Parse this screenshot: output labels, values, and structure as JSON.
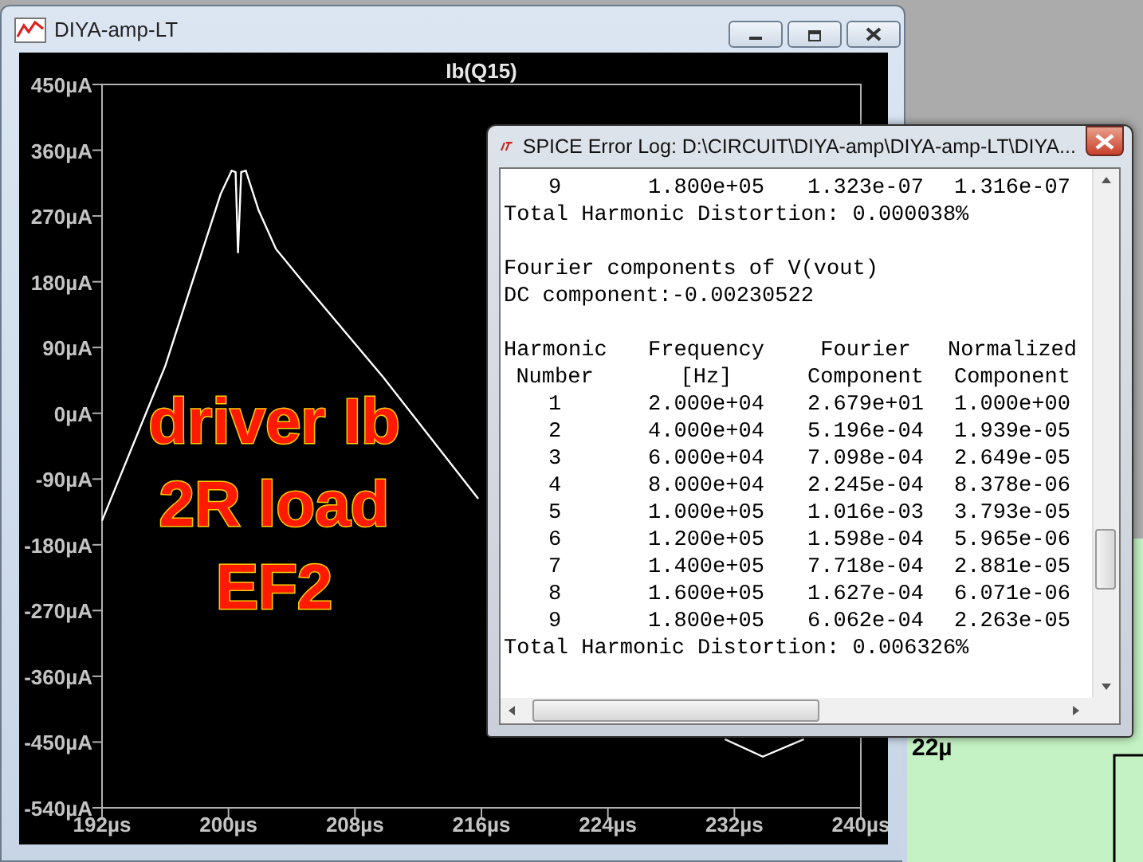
{
  "plot_window": {
    "title": "DIYA-amp-LT",
    "chart_data": {
      "type": "line",
      "title": "Ib(Q15)",
      "x": [
        192,
        196,
        199.5,
        200.2,
        200.45,
        200.6,
        200.8,
        201.1,
        201.9,
        203,
        204.7,
        209.8,
        215.8,
        231.4,
        233.8,
        236.4
      ],
      "series": [
        {
          "color": "#ffffff",
          "values": [
            -147,
            65,
            300,
            332,
            330,
            219,
            330,
            332,
            278,
            225,
            180,
            49,
            -117,
            null,
            null,
            null
          ]
        },
        {
          "color": "#ffffff",
          "values": [
            null,
            null,
            null,
            null,
            null,
            null,
            null,
            null,
            null,
            null,
            null,
            null,
            null,
            -446,
            -470,
            -446
          ]
        }
      ],
      "xlim": [
        192,
        240
      ],
      "ylim": [
        -540,
        450
      ],
      "xticks": [
        {
          "value": 192,
          "label": "192µs"
        },
        {
          "value": 200,
          "label": "200µs"
        },
        {
          "value": 208,
          "label": "208µs"
        },
        {
          "value": 216,
          "label": "216µs"
        },
        {
          "value": 224,
          "label": "224µs"
        },
        {
          "value": 232,
          "label": "232µs"
        },
        {
          "value": 240,
          "label": "240µs"
        }
      ],
      "yticks": [
        {
          "value": 450,
          "label": "450µA"
        },
        {
          "value": 360,
          "label": "360µA"
        },
        {
          "value": 270,
          "label": "270µA"
        },
        {
          "value": 180,
          "label": "180µA"
        },
        {
          "value": 90,
          "label": "90µA"
        },
        {
          "value": 0,
          "label": "0µA"
        },
        {
          "value": -90,
          "label": "-90µA"
        },
        {
          "value": -180,
          "label": "-180µA"
        },
        {
          "value": -270,
          "label": "-270µA"
        },
        {
          "value": -360,
          "label": "-360µA"
        },
        {
          "value": -450,
          "label": "-450µA"
        },
        {
          "value": -540,
          "label": "-540µA"
        }
      ]
    },
    "overlay_caption": [
      "driver Ib",
      "2R load",
      "EF2"
    ]
  },
  "schematic_window": {
    "labels": [
      "22µ"
    ]
  },
  "log_window": {
    "title": "SPICE Error Log: D:\\CIRCUIT\\DIYA-amp\\DIYA-amp-LT\\DIYA...",
    "entries": [
      {
        "kind": "row",
        "cells": [
          "9",
          "1.800e+05",
          "1.323e-07",
          "1.316e-07"
        ]
      },
      {
        "kind": "text",
        "text": "Total Harmonic Distortion: 0.000038%"
      },
      {
        "kind": "gap"
      },
      {
        "kind": "text",
        "text": "Fourier components of V(vout)"
      },
      {
        "kind": "text",
        "text": "DC component:-0.00230522"
      },
      {
        "kind": "gap"
      },
      {
        "kind": "header",
        "cells": [
          "Harmonic",
          "Frequency",
          "Fourier",
          "Normalized"
        ]
      },
      {
        "kind": "header",
        "cells": [
          "Number",
          "[Hz]",
          "Component",
          "Component"
        ]
      },
      {
        "kind": "row",
        "cells": [
          "1",
          "2.000e+04",
          "2.679e+01",
          "1.000e+00"
        ]
      },
      {
        "kind": "row",
        "cells": [
          "2",
          "4.000e+04",
          "5.196e-04",
          "1.939e-05"
        ]
      },
      {
        "kind": "row",
        "cells": [
          "3",
          "6.000e+04",
          "7.098e-04",
          "2.649e-05"
        ]
      },
      {
        "kind": "row",
        "cells": [
          "4",
          "8.000e+04",
          "2.245e-04",
          "8.378e-06"
        ]
      },
      {
        "kind": "row",
        "cells": [
          "5",
          "1.000e+05",
          "1.016e-03",
          "3.793e-05"
        ]
      },
      {
        "kind": "row",
        "cells": [
          "6",
          "1.200e+05",
          "1.598e-04",
          "5.965e-06"
        ]
      },
      {
        "kind": "row",
        "cells": [
          "7",
          "1.400e+05",
          "7.718e-04",
          "2.881e-05"
        ]
      },
      {
        "kind": "row",
        "cells": [
          "8",
          "1.600e+05",
          "1.627e-04",
          "6.071e-06"
        ]
      },
      {
        "kind": "row",
        "cells": [
          "9",
          "1.800e+05",
          "6.062e-04",
          "2.263e-05"
        ]
      },
      {
        "kind": "text",
        "text": "Total Harmonic Distortion: 0.006326%"
      }
    ]
  }
}
